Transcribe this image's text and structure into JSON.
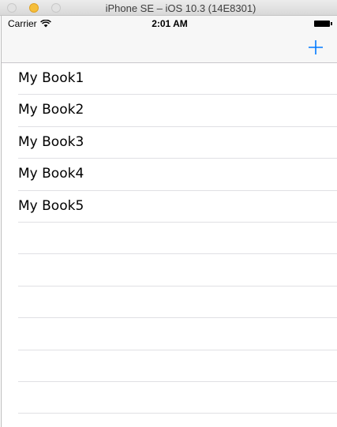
{
  "window": {
    "title": "iPhone SE – iOS 10.3 (14E8301)"
  },
  "status_bar": {
    "carrier": "Carrier",
    "time": "2:01 AM",
    "wifi_icon": "wifi-icon",
    "battery_icon": "battery-icon"
  },
  "nav_bar": {
    "add_icon": "plus-icon",
    "tint_color": "#007aff"
  },
  "books": [
    {
      "title": "My Book1"
    },
    {
      "title": "My Book2"
    },
    {
      "title": "My Book3"
    },
    {
      "title": "My Book4"
    },
    {
      "title": "My Book5"
    },
    {
      "title": ""
    },
    {
      "title": ""
    },
    {
      "title": ""
    },
    {
      "title": ""
    },
    {
      "title": ""
    },
    {
      "title": ""
    }
  ]
}
